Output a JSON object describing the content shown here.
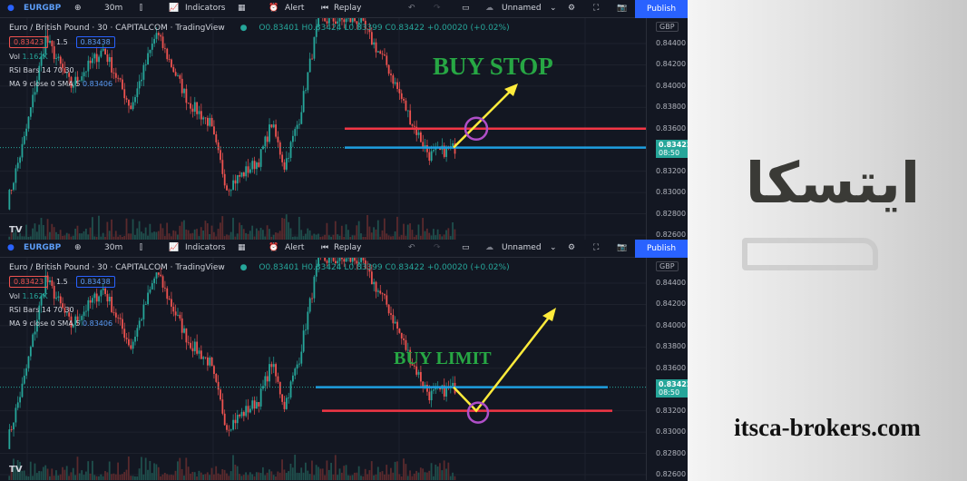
{
  "toolbar": {
    "symbol": "EURGBP",
    "interval": "30m",
    "indicators": "Indicators",
    "alert": "Alert",
    "replay": "Replay",
    "layout": "Unnamed",
    "publish": "Publish"
  },
  "legend": {
    "title": "Euro / British Pound · 30 · CAPITALCOM · TradingView",
    "ohlc": "O0.83401 H0.83424 L0.83399 C0.83422 +0.00020 (+0.02%)",
    "bid": "0.83423",
    "spread": "1.5",
    "ask": "0.83438",
    "vol_label": "Vol",
    "vol": "1.162K",
    "rsi": "RSI Bars 14 70 30",
    "ma_label": "MA 9 close 0 SMA 5",
    "ma": "0.83406"
  },
  "axis": {
    "currency": "GBP",
    "ticks": [
      "0.84400",
      "0.84200",
      "0.84000",
      "0.83800",
      "0.83600",
      "0.83200",
      "0.83000",
      "0.82800",
      "0.82600"
    ],
    "current_price": "0.83422",
    "countdown": "08:50"
  },
  "price_path": [
    [
      0,
      0.829
    ],
    [
      8,
      0.835
    ],
    [
      18,
      0.8445
    ],
    [
      30,
      0.84
    ],
    [
      45,
      0.8435
    ],
    [
      58,
      0.838
    ],
    [
      70,
      0.845
    ],
    [
      85,
      0.8385
    ],
    [
      95,
      0.8365
    ],
    [
      103,
      0.8305
    ],
    [
      118,
      0.833
    ],
    [
      124,
      0.8365
    ],
    [
      130,
      0.8325
    ],
    [
      137,
      0.837
    ],
    [
      146,
      0.8462
    ],
    [
      165,
      0.8462
    ],
    [
      178,
      0.842
    ],
    [
      190,
      0.8365
    ],
    [
      198,
      0.8335
    ],
    [
      210,
      0.8342
    ]
  ],
  "colors": {
    "up": "#26a69a",
    "down": "#ef5350",
    "red_line": "#f23645",
    "blue_line": "#1e9fe0",
    "arrow": "#ffeb3b",
    "circle": "#b04fc8",
    "text_green": "#27a744",
    "publish": "#2962ff"
  },
  "annotations": {
    "top": {
      "label": "BUY STOP",
      "red_level": 0.836,
      "blue_level": 0.83422
    },
    "bottom": {
      "label": "BUY LIMIT",
      "blue_level": 0.83422,
      "red_level": 0.832
    }
  },
  "brand": {
    "arabic": "ایتسکا",
    "website": "itsca-brokers.com"
  }
}
